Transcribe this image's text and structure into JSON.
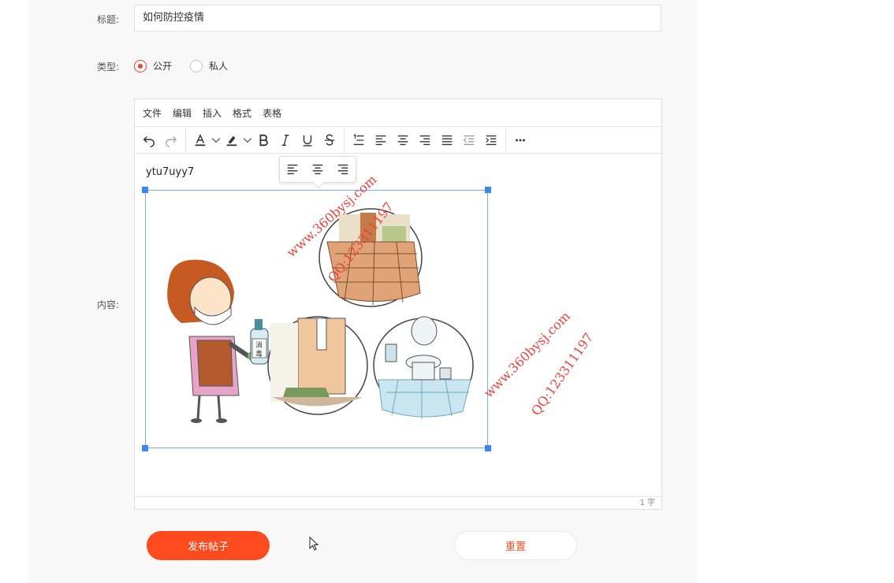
{
  "form": {
    "title_label": "标题:",
    "title_value": "如何防控疫情",
    "type_label": "类型:",
    "type_options": [
      {
        "label": "公开",
        "checked": true
      },
      {
        "label": "私人",
        "checked": false
      }
    ],
    "content_label": "内容:"
  },
  "editor": {
    "menus": [
      "文件",
      "编辑",
      "插入",
      "格式",
      "表格"
    ],
    "toolbar_icons": [
      "undo-icon",
      "redo-icon",
      "font-color-icon",
      "highlight-color-icon",
      "bold-icon",
      "italic-icon",
      "underline-icon",
      "strikethrough-icon",
      "line-height-icon",
      "align-left-icon",
      "align-center-icon",
      "align-right-icon",
      "align-justify-icon",
      "outdent-icon",
      "indent-icon",
      "more-icon"
    ],
    "content_text": "ytu7uyy7",
    "word_count": "1 字",
    "image_popover_icons": [
      "align-left-icon",
      "align-center-icon",
      "align-right-icon"
    ]
  },
  "image": {
    "disinfectant_text_line1": "消",
    "disinfectant_text_line2": "毒"
  },
  "watermarks": [
    {
      "text": "www.360bysj.com"
    },
    {
      "text": "QQ:123311197"
    },
    {
      "text": "www.360bysj.com"
    },
    {
      "text": "QQ:123311197"
    }
  ],
  "actions": {
    "publish_label": "发布帖子",
    "reset_label": "重置"
  },
  "colors": {
    "accent": "#fd4a1e",
    "radio_checked": "#e8432c",
    "selection_border": "#7aaef2",
    "selection_handle": "#3a87ef"
  }
}
